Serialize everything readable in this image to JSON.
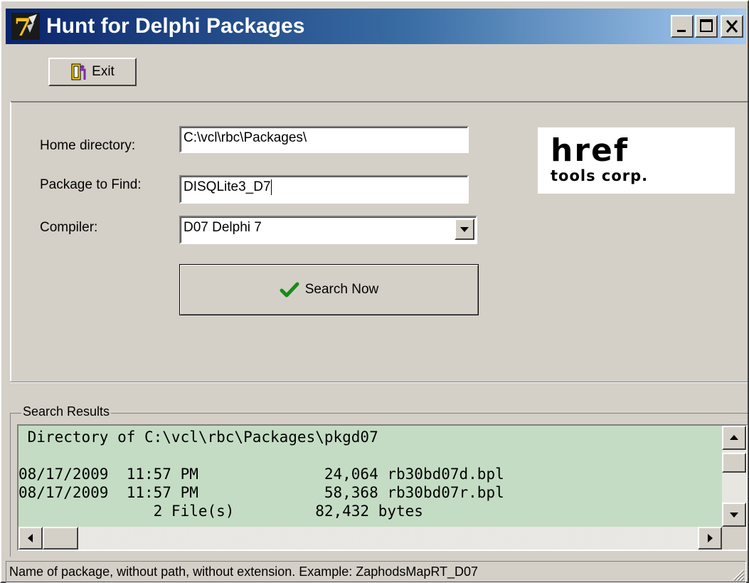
{
  "window": {
    "title": "Hunt for Delphi Packages",
    "icon": "delphi-7-icon",
    "title_gradient": [
      "#0a246a",
      "#a6caf0"
    ]
  },
  "toolbar": {
    "exit_label": "Exit",
    "exit_icon": "exit-door-icon"
  },
  "form": {
    "home_directory_label": "Home directory:",
    "home_directory_value": "C:\\vcl\\rbc\\Packages\\",
    "package_label": "Package to Find:",
    "package_value": "DISQLite3_D7",
    "compiler_label": "Compiler:",
    "compiler_value": "D07 Delphi 7",
    "search_label": "Search Now",
    "search_icon": "checkmark-icon"
  },
  "logo": {
    "main": "href",
    "sub": "tools corp."
  },
  "results": {
    "caption": "Search Results",
    "background": "#c4dcc4",
    "lines": [
      " Directory of C:\\vcl\\rbc\\Packages\\pkgd07",
      "",
      "08/17/2009  11:57 PM              24,064 rb30bd07d.bpl",
      "08/17/2009  11:57 PM              58,368 rb30bd07r.bpl",
      "               2 File(s)         82,432 bytes"
    ]
  },
  "statusbar": {
    "text": "Name of package, without path, without extension. Example: ZaphodsMapRT_D07"
  }
}
